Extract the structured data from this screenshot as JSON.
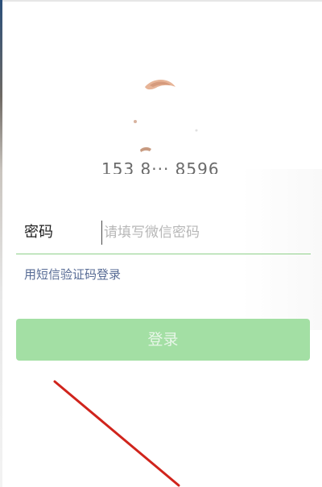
{
  "account": {
    "number_partial": "153 8··· 8596"
  },
  "password": {
    "label": "密码",
    "placeholder": "请填写微信密码"
  },
  "sms_login_link": "用短信验证码登录",
  "login_button": "登录",
  "colors": {
    "accent_green": "#8fd08a",
    "button_disabled": "#a3dfa4",
    "link_blue": "#576b95",
    "annotation_red": "#d0241c"
  }
}
